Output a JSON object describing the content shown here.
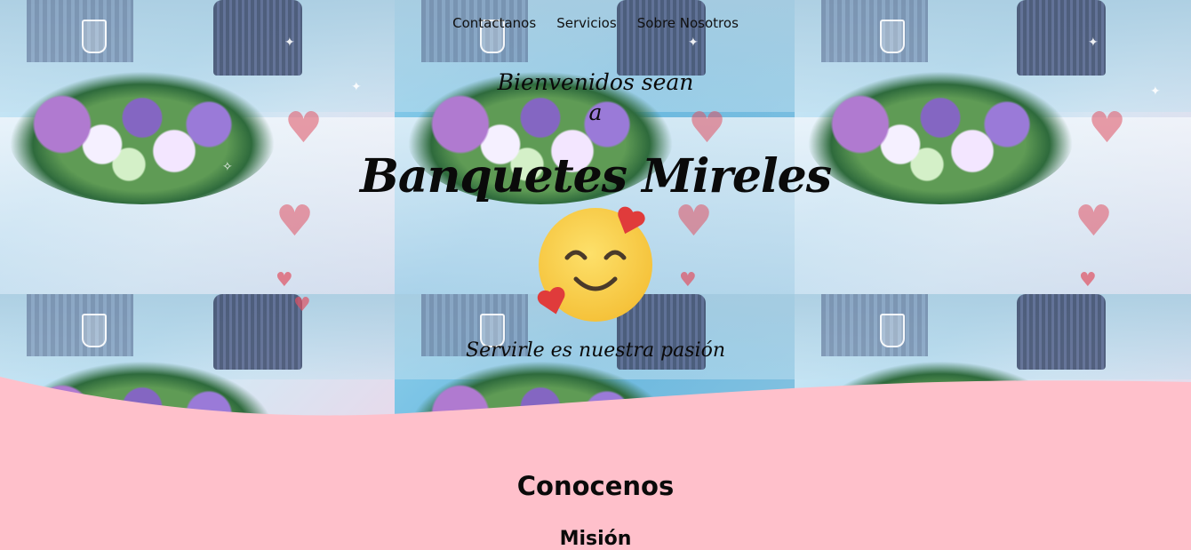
{
  "nav": {
    "items": [
      {
        "label": "Contactanos"
      },
      {
        "label": "Servicios"
      },
      {
        "label": "Sobre Nosotros"
      }
    ]
  },
  "hero": {
    "welcome_line1": "Bienvenidos sean",
    "welcome_line2": "a",
    "brand": "Banquetes Mireles",
    "emoji_icon": "smiling-face-with-hearts-icon",
    "tagline": "Servirle es nuestra pasión"
  },
  "about": {
    "title": "Conocenos",
    "subtitle": "Misión"
  },
  "colors": {
    "section_background": "#ffc0cb",
    "text": "#0a0a0a",
    "emoji_face": "#f9cf45",
    "emoji_heart": "#e03b3b"
  }
}
